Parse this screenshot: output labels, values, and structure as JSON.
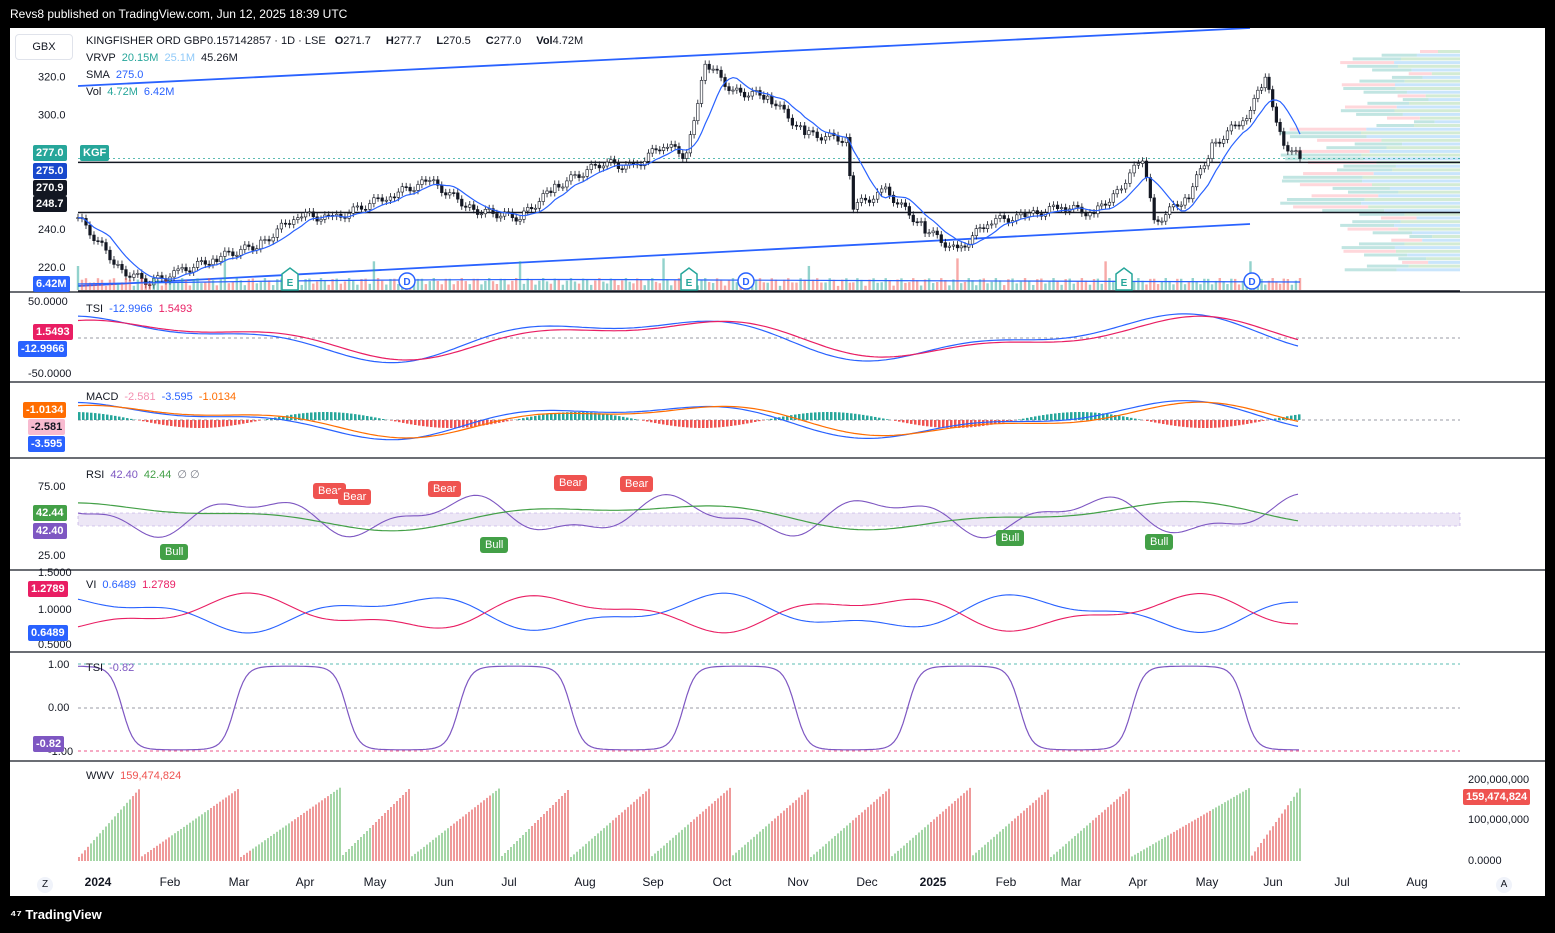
{
  "header": {
    "publisher": "Revs8 published on TradingView.com, Jun 12, 2025 18:39 UTC"
  },
  "currency_button": "GBX",
  "main": {
    "title": "KINGFISHER ORD GBP0.157142857 · 1D · LSE",
    "o_label": "O",
    "o": "271.7",
    "h_label": "H",
    "h": "277.7",
    "l_label": "L",
    "l": "270.5",
    "c_label": "C",
    "c": "277.0",
    "vol_label": "Vol",
    "vol": "4.72M",
    "vrvp_label": "VRVP",
    "vrvp_up": "20.15M",
    "vrvp_down": "25.1M",
    "vrvp_total": "45.26M",
    "sma_label": "SMA",
    "sma": "275.0",
    "volind_label": "Vol",
    "volind_a": "4.72M",
    "volind_b": "6.42M",
    "ticker": "KGF",
    "price_ticks": [
      "320.0",
      "300.0",
      "240.0",
      "220.0"
    ],
    "price_tags": [
      "277.0",
      "275.0",
      "270.9",
      "248.7"
    ],
    "vol_tag": "6.42M"
  },
  "tsi": {
    "label": "TSI",
    "v1": "-12.9966",
    "v2": "1.5493",
    "ticks": [
      "50.0000",
      "-50.0000"
    ],
    "tags": [
      "1.5493",
      "-12.9966"
    ]
  },
  "macd": {
    "label": "MACD",
    "hist": "-2.581",
    "macd": "-3.595",
    "signal": "-1.0134",
    "tags": [
      "-1.0134",
      "-2.581",
      "-3.595"
    ]
  },
  "rsi": {
    "label": "RSI",
    "v1": "42.40",
    "v2": "42.44",
    "sym": "∅ ∅",
    "ticks": [
      "75.00",
      "25.00"
    ],
    "tags": [
      "42.44",
      "42.40"
    ],
    "bear": "Bear",
    "bull": "Bull"
  },
  "vi": {
    "label": "VI",
    "plus": "0.6489",
    "minus": "1.2789",
    "ticks": [
      "1.5000",
      "1.0000",
      "0.5000"
    ],
    "tags": [
      "1.2789",
      "0.6489"
    ]
  },
  "tsi2": {
    "label": "TSI",
    "v": "-0.82",
    "ticks": [
      "1.00",
      "0.00",
      "-1.00"
    ],
    "tag": "-0.82"
  },
  "wwv": {
    "label": "WWV",
    "v": "159,474,824",
    "ticks": [
      "200,000,000",
      "100,000,000",
      "0.0000"
    ],
    "tag": "159,474,824"
  },
  "time_axis": [
    "2024",
    "Feb",
    "Mar",
    "Apr",
    "May",
    "Jun",
    "Jul",
    "Aug",
    "Sep",
    "Oct",
    "Nov",
    "Dec",
    "2025",
    "Feb",
    "Mar",
    "Apr",
    "May",
    "Jun",
    "Jul",
    "Aug"
  ],
  "buttons": {
    "zoom": "Z",
    "auto": "A"
  },
  "event_labels": {
    "earnings": "E",
    "dividend": "D"
  },
  "footer": {
    "brand": "TradingView"
  },
  "chart_data": {
    "type": "line",
    "series": [
      {
        "name": "KGF",
        "points": [
          [
            "2024-01-01",
            246
          ],
          [
            "2024-01-20",
            218
          ],
          [
            "2024-02-01",
            212
          ],
          [
            "2024-02-15",
            218
          ],
          [
            "2024-03-01",
            225
          ],
          [
            "2024-03-20",
            232
          ],
          [
            "2024-04-05",
            248
          ],
          [
            "2024-04-20",
            245
          ],
          [
            "2024-05-15",
            258
          ],
          [
            "2024-06-01",
            265
          ],
          [
            "2024-06-20",
            250
          ],
          [
            "2024-07-10",
            246
          ],
          [
            "2024-07-25",
            262
          ],
          [
            "2024-08-15",
            275
          ],
          [
            "2024-08-28",
            272
          ],
          [
            "2024-09-10",
            285
          ],
          [
            "2024-09-20",
            278
          ],
          [
            "2024-09-28",
            328
          ],
          [
            "2024-10-10",
            312
          ],
          [
            "2024-10-25",
            310
          ],
          [
            "2024-11-10",
            290
          ],
          [
            "2024-11-28",
            287
          ],
          [
            "2024-12-01",
            252
          ],
          [
            "2024-12-15",
            260
          ],
          [
            "2025-01-01",
            240
          ],
          [
            "2025-01-15",
            228
          ],
          [
            "2025-01-28",
            244
          ],
          [
            "2025-02-15",
            247
          ],
          [
            "2025-03-01",
            252
          ],
          [
            "2025-03-15",
            248
          ],
          [
            "2025-03-25",
            260
          ],
          [
            "2025-04-05",
            277
          ],
          [
            "2025-04-10",
            243
          ],
          [
            "2025-04-25",
            258
          ],
          [
            "2025-05-05",
            283
          ],
          [
            "2025-05-20",
            300
          ],
          [
            "2025-05-28",
            318
          ],
          [
            "2025-06-05",
            285
          ],
          [
            "2025-06-12",
            277
          ]
        ]
      }
    ],
    "ylim": [
      208,
      335
    ],
    "levels": [
      275.0,
      248.7
    ]
  }
}
